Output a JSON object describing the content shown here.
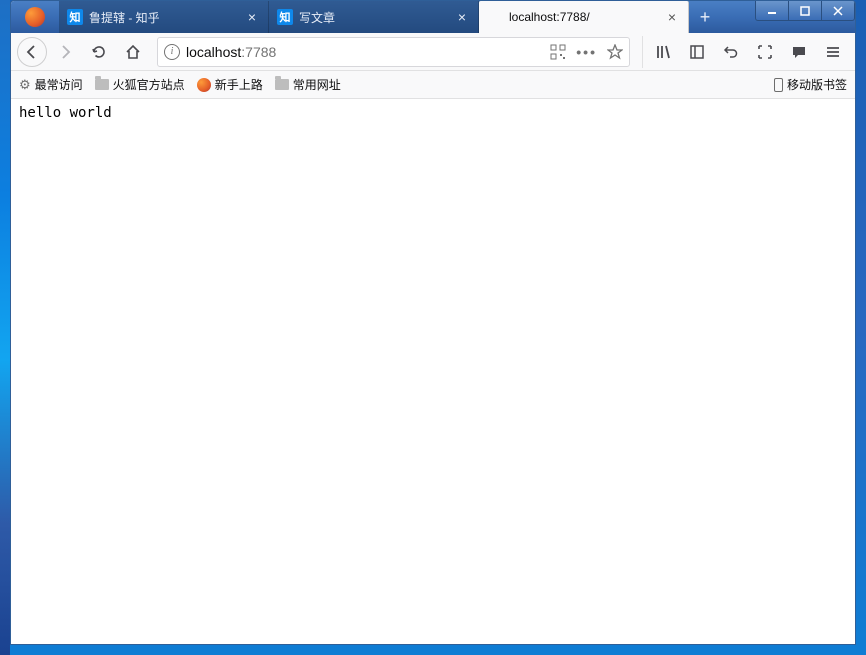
{
  "tabs": [
    {
      "favicon_type": "zhi",
      "favicon_text": "知",
      "title": "鲁提辖 - 知乎"
    },
    {
      "favicon_type": "zhi",
      "favicon_text": "知",
      "title": "写文章"
    },
    {
      "favicon_type": "none",
      "title": "localhost:7788/"
    }
  ],
  "urlbar": {
    "host": "localhost",
    "port": ":7788"
  },
  "bookmarks": {
    "most_visited": "最常访问",
    "official": "火狐官方站点",
    "getting_started": "新手上路",
    "common": "常用网址",
    "mobile": "移动版书签"
  },
  "page": {
    "body_text": "hello world"
  }
}
